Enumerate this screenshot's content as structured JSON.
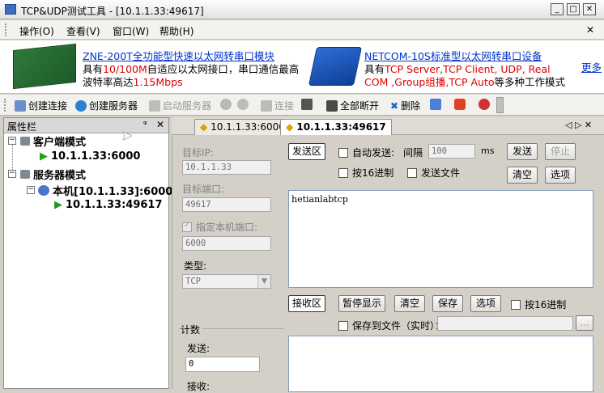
{
  "window": {
    "title": "TCP&UDP测试工具 - [10.1.1.33:49617]"
  },
  "menu": [
    "操作(O)",
    "查看(V)",
    "窗口(W)",
    "帮助(H)"
  ],
  "ads": {
    "left": {
      "title": "ZNE-200T全功能型快速以太网转串口模块",
      "line1_a": "具有",
      "line1_b": "10/100M",
      "line1_c": "自适应以太网接口，串口通信最高",
      "line2_a": "波特率高达",
      "line2_b": "1.15Mbps"
    },
    "right": {
      "title": "NETCOM-10S标准型以太网转串口设备",
      "line1_a": "具有",
      "line1_b": "TCP Server,TCP Client, UDP, Real",
      "line2_a": "COM ,Group组播,TCP Auto",
      "line2_b": "等多种工作模式"
    },
    "more": "更多"
  },
  "toolbar": {
    "create_conn": "创建连接",
    "create_server": "创建服务器",
    "start_server": "启动服务器",
    "connect": "连接",
    "disconnect_all": "全部断开",
    "delete": "删除"
  },
  "left_panel": {
    "title": "属性栏",
    "pin": "ᵠ",
    "close": "✕",
    "tree": [
      {
        "label": "客户端模式"
      },
      {
        "label": "10.1.1.33:6000"
      },
      {
        "label": "服务器模式"
      },
      {
        "label": "本机[10.1.1.33]:6000"
      },
      {
        "label": "10.1.1.33:49617"
      }
    ]
  },
  "tabs": [
    {
      "label": "10.1.1.33:6000"
    },
    {
      "label": "10.1.1.33:49617"
    }
  ],
  "tab_nav": "◁ ▷ ✕",
  "form": {
    "target_ip_label": "目标IP:",
    "target_ip": "10.1.1.33",
    "target_port_label": "目标端口:",
    "target_port": "49617",
    "local_port_label": "指定本机端口:",
    "local_port": "6000",
    "type_label": "类型:",
    "type": "TCP",
    "count_label": "计数",
    "send_label": "发送:",
    "send_count": "0",
    "recv_label": "接收:"
  },
  "send": {
    "area_btn": "发送区",
    "auto_send": "自动发送:",
    "interval_label": "间隔",
    "interval": "100",
    "unit": "ms",
    "send_btn": "发送",
    "stop_btn": "停止",
    "hex16": "按16进制",
    "send_file": "发送文件",
    "clear_btn": "清空",
    "options_btn": "选项",
    "text": "hetianlabtcp"
  },
  "recv": {
    "area_btn": "接收区",
    "pause_btn": "暂停显示",
    "clear_btn": "清空",
    "save_btn": "保存",
    "options_btn": "选项",
    "hex16": "按16进制",
    "save_file": "保存到文件（实时）：",
    "browse": "..."
  }
}
